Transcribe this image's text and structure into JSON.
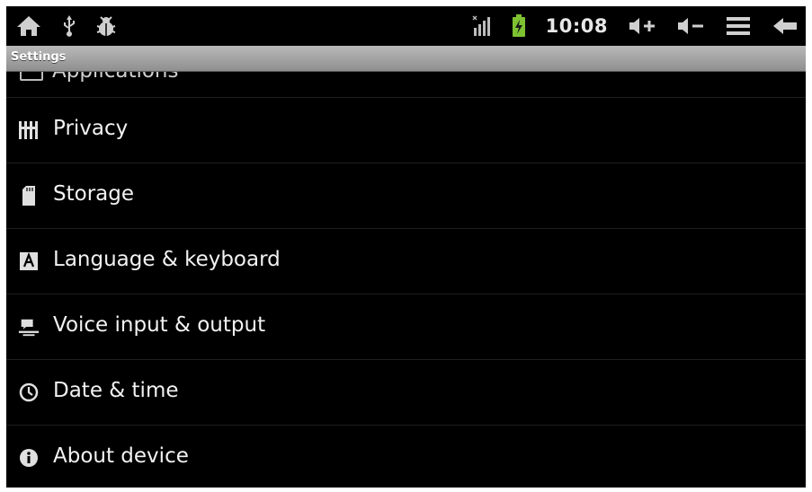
{
  "status_bar": {
    "time": "10:08",
    "left_icons": [
      "home-icon",
      "usb-icon",
      "android-debug-icon"
    ],
    "right_icons": [
      "signal-icon",
      "battery-charging-icon",
      "volume-up-icon",
      "volume-down-icon",
      "menu-icon",
      "back-icon"
    ]
  },
  "title_bar": {
    "title": "Settings"
  },
  "list": {
    "cut_item": {
      "label": "Applications"
    },
    "items": [
      {
        "label": "Privacy",
        "icon": "privacy-icon"
      },
      {
        "label": "Storage",
        "icon": "sd-card-icon"
      },
      {
        "label": "Language & keyboard",
        "icon": "language-icon"
      },
      {
        "label": "Voice input & output",
        "icon": "voice-icon"
      },
      {
        "label": "Date & time",
        "icon": "clock-icon"
      },
      {
        "label": "About device",
        "icon": "info-icon"
      }
    ]
  },
  "colors": {
    "background": "#000000",
    "title_bar": "#a6a6a6",
    "text": "#f2f2f2",
    "battery": "#7ec232"
  }
}
